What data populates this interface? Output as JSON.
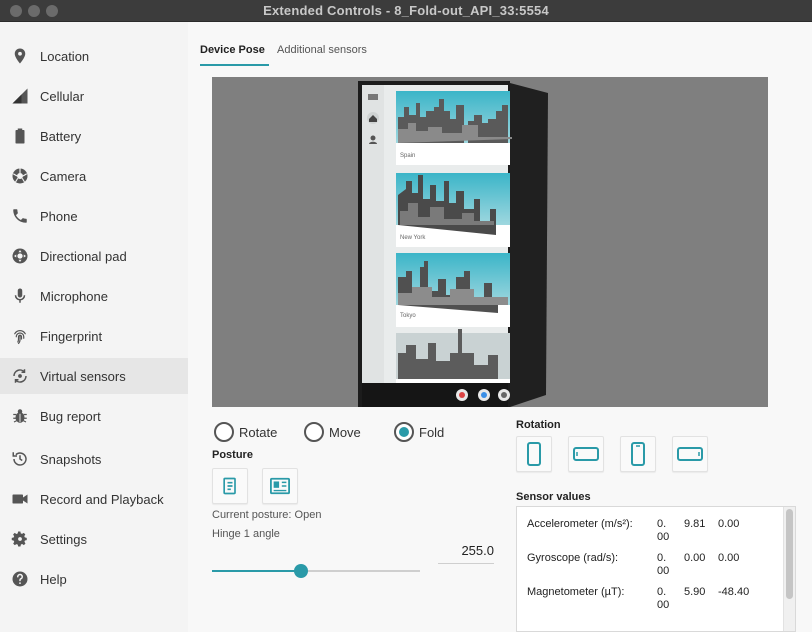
{
  "window": {
    "title": "Extended Controls - 8_Fold-out_API_33:5554"
  },
  "sidebar": {
    "items": [
      {
        "label": "Location",
        "icon": "location-pin-icon"
      },
      {
        "label": "Cellular",
        "icon": "signal-icon"
      },
      {
        "label": "Battery",
        "icon": "battery-icon"
      },
      {
        "label": "Camera",
        "icon": "camera-aperture-icon"
      },
      {
        "label": "Phone",
        "icon": "phone-icon"
      },
      {
        "label": "Directional pad",
        "icon": "dpad-icon"
      },
      {
        "label": "Microphone",
        "icon": "microphone-icon"
      },
      {
        "label": "Fingerprint",
        "icon": "fingerprint-icon"
      },
      {
        "label": "Virtual sensors",
        "icon": "rotate-sensor-icon"
      },
      {
        "label": "Bug report",
        "icon": "bug-icon"
      },
      {
        "label": "Snapshots",
        "icon": "history-icon"
      },
      {
        "label": "Record and Playback",
        "icon": "video-camera-icon"
      },
      {
        "label": "Settings",
        "icon": "gear-icon"
      },
      {
        "label": "Help",
        "icon": "help-icon"
      }
    ],
    "active_index": 8
  },
  "tabs": [
    {
      "label": "Device Pose",
      "active": true
    },
    {
      "label": "Additional sensors",
      "active": false
    }
  ],
  "device_screen": {
    "cards": [
      {
        "label": "Spain"
      },
      {
        "label": "New York"
      },
      {
        "label": "Tokyo"
      },
      {
        "label": ""
      }
    ]
  },
  "mode": {
    "options": [
      "Rotate",
      "Move",
      "Fold"
    ],
    "selected": "Fold"
  },
  "posture": {
    "heading": "Posture",
    "current_text": "Current posture: Open",
    "icons": [
      "book-posture-icon",
      "tablet-posture-icon"
    ]
  },
  "hinge": {
    "label": "Hinge 1 angle",
    "value": "255.0",
    "fraction": 0.43
  },
  "rotation": {
    "heading": "Rotation",
    "icons": [
      "portrait-icon",
      "landscape-icon",
      "reverse-portrait-icon",
      "reverse-landscape-icon"
    ]
  },
  "sensors": {
    "heading": "Sensor values",
    "rows": [
      {
        "label": "Accelerometer (m/s²):",
        "v1": "0.",
        "v1b": "00",
        "v2": "9.81",
        "v3": "0.00"
      },
      {
        "label": "Gyroscope (rad/s):",
        "v1": "0.",
        "v1b": "00",
        "v2": "0.00",
        "v3": "0.00"
      },
      {
        "label": "Magnetometer (µT):",
        "v1": "0.",
        "v1b": "00",
        "v2": "5.90",
        "v3": "-48.40"
      }
    ]
  },
  "colors": {
    "accent": "#2a9aa8",
    "viewport_bg": "#7f7f7f"
  }
}
